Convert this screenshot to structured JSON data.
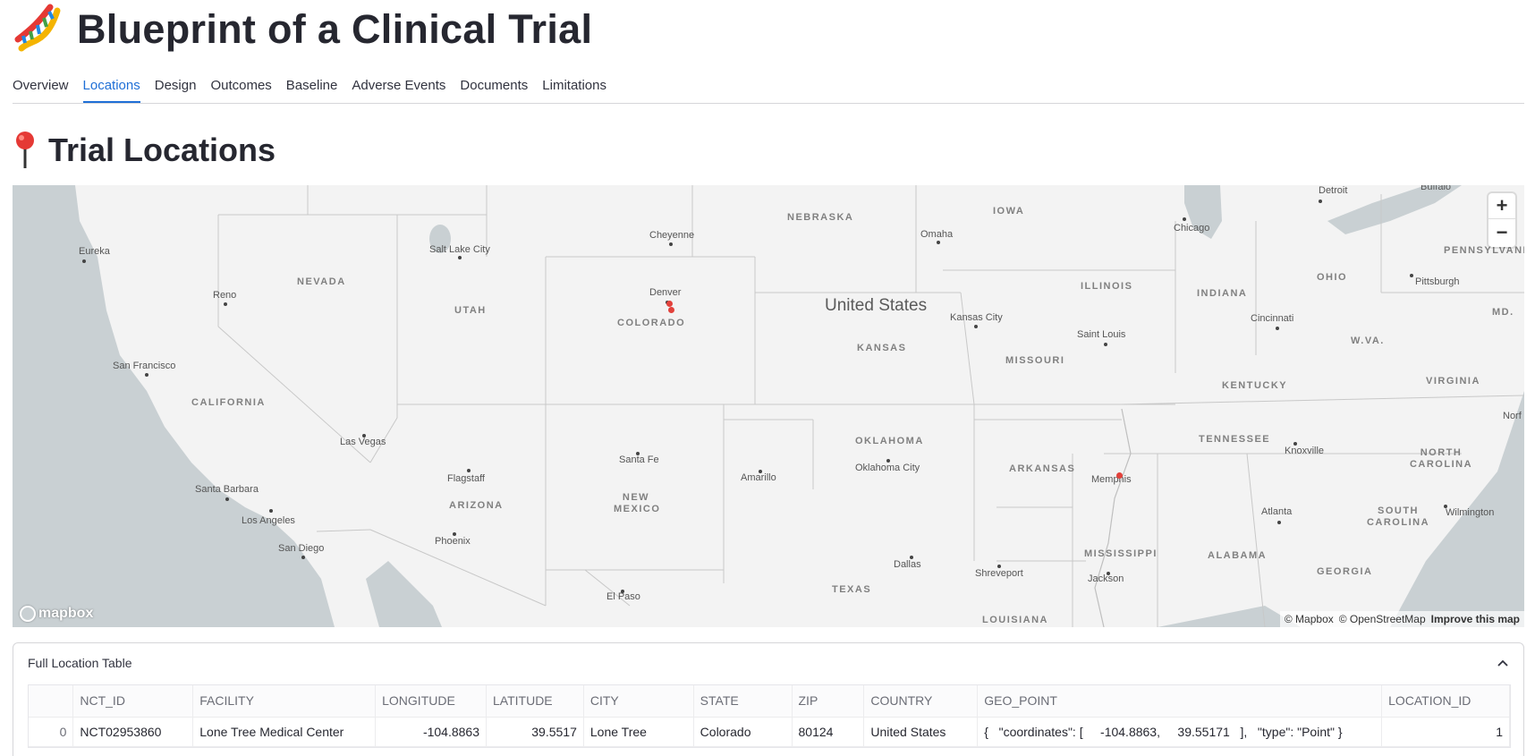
{
  "app": {
    "title": "Blueprint of a Clinical Trial",
    "icon": "dna-icon"
  },
  "tabs": [
    {
      "label": "Overview",
      "active": false
    },
    {
      "label": "Locations",
      "active": true
    },
    {
      "label": "Design",
      "active": false
    },
    {
      "label": "Outcomes",
      "active": false
    },
    {
      "label": "Baseline",
      "active": false
    },
    {
      "label": "Adverse Events",
      "active": false
    },
    {
      "label": "Documents",
      "active": false
    },
    {
      "label": "Limitations",
      "active": false
    }
  ],
  "section": {
    "title": "Trial Locations",
    "icon": "round-pushpin-icon"
  },
  "map": {
    "country_label": "United States",
    "state_labels": [
      "NEBRASKA",
      "IOWA",
      "NEVADA",
      "UTAH",
      "COLORADO",
      "KANSAS",
      "ILLINOIS",
      "INDIANA",
      "OHIO",
      "PENNSYLVANIA",
      "MISSOURI",
      "CALIFORNIA",
      "OKLAHOMA",
      "ARKANSAS",
      "TENNESSEE",
      "KENTUCKY",
      "VIRGINIA",
      "W.VA.",
      "MD.",
      "NORTH CAROLINA",
      "SOUTH CAROLINA",
      "ARIZONA",
      "NEW MEXICO",
      "TEXAS",
      "MISSISSIPPI",
      "ALABAMA",
      "GEORGIA",
      "LOUISIANA"
    ],
    "city_labels": [
      "Detroit",
      "Buffalo",
      "Chicago",
      "Cheyenne",
      "Omaha",
      "Salt Lake City",
      "Eureka",
      "Reno",
      "Denver",
      "Kansas City",
      "Saint Louis",
      "Cincinnati",
      "Pittsburgh",
      "San Francisco",
      "Las Vegas",
      "Santa Fe",
      "Amarillo",
      "Oklahoma City",
      "Memphis",
      "Knoxville",
      "Flagstaff",
      "Santa Barbara",
      "Los Angeles",
      "San Diego",
      "Phoenix",
      "Atlanta",
      "Wilmington",
      "Dallas",
      "Shreveport",
      "Jackson",
      "El Paso",
      "Norf"
    ],
    "zoom_in": "+",
    "zoom_out": "−",
    "logo_text": "mapbox",
    "attribution": [
      "© Mapbox",
      "© OpenStreetMap"
    ],
    "improve_link": "Improve this map",
    "marker_color": "#e2413b"
  },
  "expander": {
    "title": "Full Location Table",
    "expanded": true
  },
  "table": {
    "columns": [
      "",
      "NCT_ID",
      "FACILITY",
      "LONGITUDE",
      "LATITUDE",
      "CITY",
      "STATE",
      "ZIP",
      "COUNTRY",
      "GEO_POINT",
      "LOCATION_ID"
    ],
    "rows": [
      [
        "0",
        "NCT02953860",
        "Lone Tree Medical Center",
        "-104.8863",
        "39.5517",
        "Lone Tree",
        "Colorado",
        "80124",
        "United States",
        "{   \"coordinates\": [     -104.8863,     39.55171   ],   \"type\": \"Point\" }",
        "1"
      ]
    ]
  },
  "colors": {
    "accent": "#1f6fd6",
    "text": "#31333f",
    "map_bg": "#f3f3f3",
    "water": "#c9d0d3"
  }
}
